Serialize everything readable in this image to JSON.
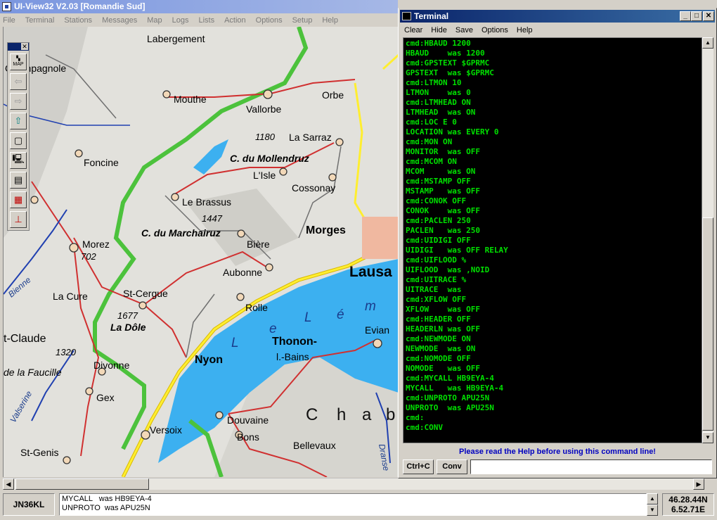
{
  "app": {
    "title": "UI-View32 V2.03 [Romandie Sud]",
    "menu": [
      "File",
      "Terminal",
      "Stations",
      "Messages",
      "Map",
      "Logs",
      "Lists",
      "Action",
      "Options",
      "Setup",
      "Help"
    ]
  },
  "toolbar": {
    "buttons": [
      {
        "name": "map-icon",
        "label": "MAP",
        "enabled": true
      },
      {
        "name": "back-arrow-icon",
        "enabled": false
      },
      {
        "name": "forward-arrow-icon",
        "enabled": false
      },
      {
        "name": "up-arrow-icon",
        "enabled": true
      },
      {
        "name": "frame-icon",
        "enabled": true
      },
      {
        "name": "computer-icon",
        "enabled": true
      },
      {
        "name": "list-icon",
        "enabled": true
      },
      {
        "name": "calendar-icon",
        "enabled": true
      },
      {
        "name": "antenna-icon",
        "enabled": true
      }
    ]
  },
  "map": {
    "places": {
      "labergement": "Labergement",
      "champagnole": "Champagnole",
      "mouthe": "Mouthe",
      "vallorbe": "Vallorbe",
      "orbe": "Orbe",
      "foncine": "Foncine",
      "alt1180": "1180",
      "la_sarraz": "La Sarraz",
      "mollendruz": "C. du Mollendruz",
      "lisle": "L'Isle",
      "cossonay": "Cossonay",
      "le_brassus": "Le Brassus",
      "alt1447": "1447",
      "marchairuz": "C. du Marchairuz",
      "morges": "Morges",
      "morez": "Morez",
      "alt702": "702",
      "biere": "Bière",
      "bienne": "Bienne",
      "aubonne": "Aubonne",
      "lausanne": "Lausa",
      "la_cure": "La Cure",
      "st_cergue": "St-Cergue",
      "rolle": "Rolle",
      "alt1677": "1677",
      "la_dole": "La Dôle",
      "lake_l": "L",
      "lake_e1": "e",
      "lake_l2": "L",
      "lake_e2": "é",
      "lake_m": "m",
      "st_claude": "t-Claude",
      "evian": "Evian",
      "thonon": "Thonon-",
      "les_bains": "l.-Bains",
      "alt1320": "1320",
      "faucille": "de la Faucille",
      "divonne": "Divonne",
      "nyon": "Nyon",
      "gex": "Gex",
      "valserine": "Valserine",
      "chab_c": "C",
      "chab_h": "h",
      "chab_a": "a",
      "chab_b": "b",
      "douvaine": "Douvaine",
      "versoix": "Versoix",
      "bons": "Bons",
      "dranse": "Dranse",
      "st_genis": "St-Genis",
      "bellevaux": "Bellevaux"
    }
  },
  "terminal": {
    "title": "Terminal",
    "menu": [
      "Clear",
      "Hide",
      "Save",
      "Options",
      "Help"
    ],
    "lines": [
      "cmd:HBAUD 1200",
      "HBAUD    was 1200",
      "cmd:GPSTEXT $GPRMC",
      "GPSTEXT  was $GPRMC",
      "cmd:LTMON 10",
      "LTMON    was 0",
      "cmd:LTMHEAD ON",
      "LTMHEAD  was ON",
      "cmd:LOC E 0",
      "LOCATION was EVERY 0",
      "cmd:MON ON",
      "MONITOR  was OFF",
      "cmd:MCOM ON",
      "MCOM     was ON",
      "cmd:MSTAMP OFF",
      "MSTAMP   was OFF",
      "cmd:CONOK OFF",
      "CONOK    was OFF",
      "cmd:PACLEN 250",
      "PACLEN   was 250",
      "cmd:UIDIGI OFF",
      "UIDIGI   was OFF RELAY",
      "cmd:UIFLOOD %",
      "UIFLOOD  was ,NOID",
      "cmd:UITRACE %",
      "UITRACE  was",
      "cmd:XFLOW OFF",
      "XFLOW    was OFF",
      "cmd:HEADER OFF",
      "HEADERLN was OFF",
      "cmd:NEWMODE ON",
      "NEWMODE  was ON",
      "cmd:NOMODE OFF",
      "NOMODE   was OFF",
      "cmd:MYCALL HB9EYA-4",
      "MYCALL   was HB9EYA-4",
      "cmd:UNPROTO APU25N",
      "UNPROTO  was APU25N",
      "cmd:",
      "cmd:CONV"
    ],
    "help_text": "Please read the Help before using this command line!",
    "ctrlc_label": "Ctrl+C",
    "conv_label": "Conv",
    "input_value": ""
  },
  "status": {
    "locator": "JN36KL",
    "log_line1": "MYCALL   was HB9EYA-4",
    "log_line2": "UNPROTO  was APU25N",
    "lat": "46.28.44N",
    "lon": "6.52.71E"
  }
}
